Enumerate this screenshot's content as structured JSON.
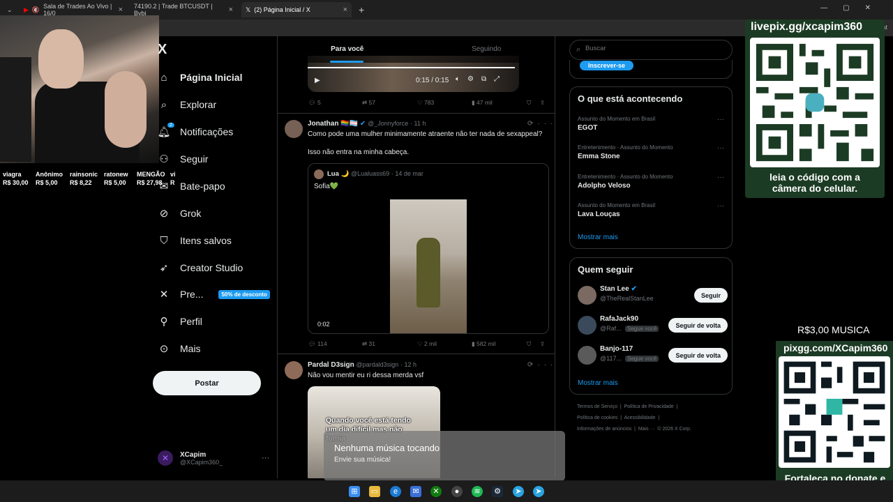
{
  "browser": {
    "tabs": [
      {
        "label": "Sala de Trades Ao Vivo | 16/0"
      },
      {
        "label": "74190.2 | Trade BTCUSDT | Bybi"
      },
      {
        "label": "(2) Página Inicial / X"
      }
    ],
    "new_tab": "+",
    "addr_extra": "hat"
  },
  "donors": [
    {
      "name": "viagra",
      "amount": "R$ 30,00"
    },
    {
      "name": "Anônimo",
      "amount": "R$ 5,00"
    },
    {
      "name": "rainsonic",
      "amount": "R$ 8,22"
    },
    {
      "name": "ratonew",
      "amount": "R$ 5,00"
    },
    {
      "name": "MENGÃO",
      "amount": "R$ 27,98"
    },
    {
      "name": "vi",
      "amount": "R"
    }
  ],
  "nav": {
    "logo": "X",
    "items": [
      {
        "label": "Página Inicial",
        "icon": "home-icon"
      },
      {
        "label": "Explorar",
        "icon": "search-icon"
      },
      {
        "label": "Notificações",
        "icon": "bell-icon",
        "badge": "2"
      },
      {
        "label": "Seguir",
        "icon": "add-user-icon"
      },
      {
        "label": "Bate-papo",
        "icon": "mail-icon"
      },
      {
        "label": "Grok",
        "icon": "grok-icon"
      },
      {
        "label": "Itens salvos",
        "icon": "bookmark-icon"
      },
      {
        "label": "Creator Studio",
        "icon": "rocket-icon"
      },
      {
        "label": "Pre...",
        "icon": "x-icon",
        "promo": "50% de desconto"
      },
      {
        "label": "Perfil",
        "icon": "person-icon"
      },
      {
        "label": "Mais",
        "icon": "more-icon"
      }
    ],
    "post_button": "Postar",
    "profile": {
      "name": "XCapim",
      "handle": "@XCapim360_",
      "more": "···"
    }
  },
  "feed": {
    "tabs": [
      "Para você",
      "Seguindo"
    ],
    "video": {
      "time": "0:15 / 0:15"
    },
    "post0_actions": {
      "replies": "5",
      "reposts": "57",
      "likes": "783",
      "views": "47 mil"
    },
    "post1": {
      "name": "Jonathan 🏳️‍🌈🏳️‍⚧️",
      "handle": "@_Jonnyforce",
      "time": "· 11 h",
      "text1": "Como pode uma mulher minimamente atraente não ter nada de sexappeal?",
      "text2": "Isso não entra na minha cabeça.",
      "quote": {
        "name": "Lua 🌙",
        "handle": "@Lualuass69",
        "date": "· 14 de mar",
        "text": "Sofia💚",
        "duration": "0:02"
      },
      "actions": {
        "replies": "114",
        "reposts": "31",
        "likes": "2 mil",
        "views": "582 mil"
      }
    },
    "post2": {
      "name": "Pardal D3sign",
      "handle": "@pardald3sign",
      "time": "· 12 h",
      "text": "Não vou mentir eu ri dessa merda vsf",
      "meme_text": "Quando você está tendo um dia difícil mas não fumia"
    }
  },
  "right": {
    "search_placeholder": "Buscar",
    "subscribe": "Inscrever-se",
    "trends_title": "O que está acontecendo",
    "trends": [
      {
        "category": "Assunto do Momento em Brasil",
        "name": "EGOT"
      },
      {
        "category": "Entretenimento · Assunto do Momento",
        "name": "Emma Stone"
      },
      {
        "category": "Entretenimento · Assunto do Momento",
        "name": "Adolpho Veloso"
      },
      {
        "category": "Assunto do Momento em Brasil",
        "name": "Lava Louças"
      }
    ],
    "show_more": "Mostrar mais",
    "wtf_title": "Quem seguir",
    "wtf": [
      {
        "name": "Stan Lee",
        "handle": "@TheRealStanLee",
        "button": "Seguir",
        "follows_you": ""
      },
      {
        "name": "RafaJack90",
        "handle": "@Raf...",
        "button": "Seguir de volta",
        "follows_you": "Segue você"
      },
      {
        "name": "Banjo-117",
        "handle": "@117...",
        "button": "Seguir de volta",
        "follows_you": "Segue você"
      }
    ],
    "footer": [
      [
        "Termos de Serviço",
        "|",
        "Política de Privacidade",
        "|"
      ],
      [
        "Política de cookies",
        "|",
        "Acessibilidade",
        "|"
      ],
      [
        "Informações de anúncios",
        "|",
        "Mais ···",
        "© 2026 X Corp."
      ]
    ]
  },
  "overlays": {
    "livepix_url": "livepix.gg/xcapim360",
    "livepix_caption": "leia o código com a câmera do celular.",
    "music_price": "R$3,00 MUSICA",
    "pixgg_url": "pixgg.com/XCapim360",
    "pixgg_caption": "Fortaleça no donate e envie sua mensagem!",
    "music_title": "Nenhuma música tocando",
    "music_sub": "Envie sua música!"
  },
  "colors": {
    "accent": "#1d9bf0",
    "bg": "#000000",
    "border": "#2f3336",
    "muted": "#71767b",
    "overlay_green": "#1c3b24"
  }
}
